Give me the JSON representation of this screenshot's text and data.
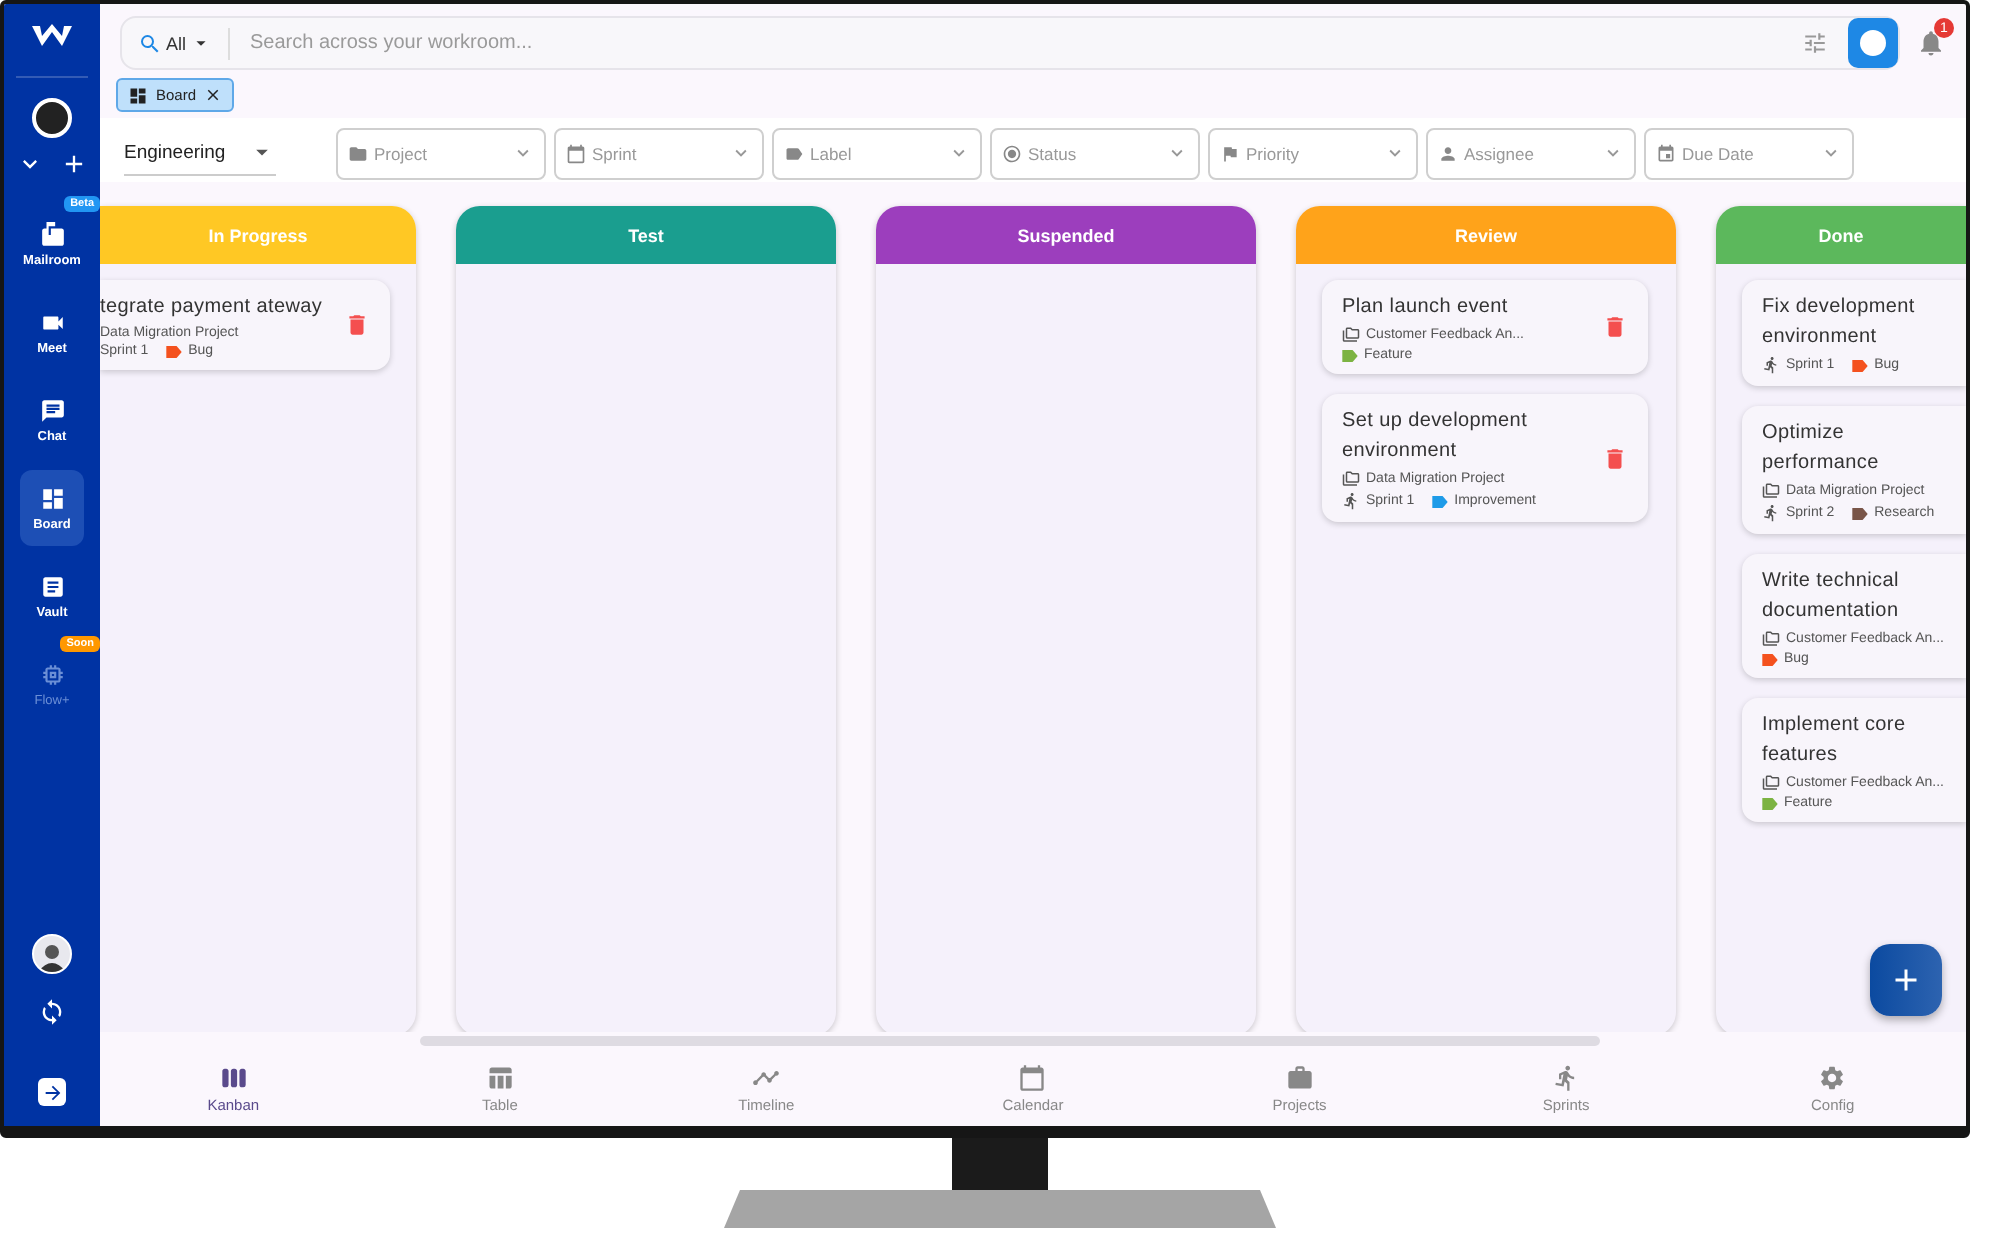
{
  "sidebar": {
    "items": [
      {
        "kind": "mailroom",
        "label": "Mailroom",
        "badge": {
          "text": "Beta",
          "color": "#2196f3"
        },
        "selected": false,
        "disabled": false
      },
      {
        "kind": "meet",
        "label": "Meet",
        "selected": false,
        "disabled": false
      },
      {
        "kind": "chat",
        "label": "Chat",
        "selected": false,
        "disabled": false
      },
      {
        "kind": "board",
        "label": "Board",
        "selected": true,
        "disabled": false
      },
      {
        "kind": "vault",
        "label": "Vault",
        "selected": false,
        "disabled": false
      },
      {
        "kind": "flow",
        "label": "Flow+",
        "badge": {
          "text": "Soon",
          "color": "#ff9800"
        },
        "selected": false,
        "disabled": true
      }
    ]
  },
  "search": {
    "scope": "All",
    "placeholder": "Search across your workroom..."
  },
  "notifications": {
    "count": "1"
  },
  "open_tabs": [
    {
      "label": "Board"
    }
  ],
  "team": "Engineering",
  "filters": [
    {
      "kind": "project",
      "placeholder": "Project"
    },
    {
      "kind": "sprint",
      "placeholder": "Sprint"
    },
    {
      "kind": "label",
      "placeholder": "Label"
    },
    {
      "kind": "status",
      "placeholder": "Status"
    },
    {
      "kind": "priority",
      "placeholder": "Priority"
    },
    {
      "kind": "assignee",
      "placeholder": "Assignee"
    },
    {
      "kind": "due",
      "placeholder": "Due Date"
    }
  ],
  "columns": [
    {
      "title": "In Progress",
      "color": "#ffc824",
      "cards": [
        {
          "title": "tegrate payment ateway",
          "project": "Data Migration Project",
          "sprint": "Sprint 1",
          "label": {
            "text": "Bug",
            "color": "#f4511e"
          },
          "deletable": true
        }
      ]
    },
    {
      "title": "Test",
      "color": "#1a9e8f"
    },
    {
      "title": "Suspended",
      "color": "#9c3ebd"
    },
    {
      "title": "Review",
      "color": "#ffa31a",
      "cards": [
        {
          "title": "Plan launch event",
          "project": "Customer Feedback An...",
          "label": {
            "text": "Feature",
            "color": "#7cb342"
          },
          "deletable": true
        },
        {
          "title": "Set up development environment",
          "project": "Data Migration Project",
          "sprint": "Sprint 1",
          "label": {
            "text": "Improvement",
            "color": "#1e9be8"
          },
          "deletable": true
        }
      ]
    },
    {
      "title": "Done",
      "color": "#5cb85c",
      "cards": [
        {
          "title": "Fix development environment",
          "sprint": "Sprint 1",
          "label": {
            "text": "Bug",
            "color": "#f4511e"
          },
          "deletable": false
        },
        {
          "title": "Optimize performance",
          "project": "Data Migration Project",
          "sprint": "Sprint 2",
          "label": {
            "text": "Research",
            "color": "#795548"
          },
          "deletable": false
        },
        {
          "title": "Write technical documentation",
          "project": "Customer Feedback An...",
          "label": {
            "text": "Bug",
            "color": "#f4511e"
          },
          "deletable": false
        },
        {
          "title": "Implement core features",
          "project": "Customer Feedback An...",
          "label": {
            "text": "Feature",
            "color": "#7cb342"
          },
          "deletable": false
        }
      ]
    }
  ],
  "bottom_nav": [
    {
      "kind": "kanban",
      "label": "Kanban",
      "selected": true
    },
    {
      "kind": "table",
      "label": "Table",
      "selected": false
    },
    {
      "kind": "timeline",
      "label": "Timeline",
      "selected": false
    },
    {
      "kind": "calendar",
      "label": "Calendar",
      "selected": false
    },
    {
      "kind": "projects",
      "label": "Projects",
      "selected": false
    },
    {
      "kind": "sprints",
      "label": "Sprints",
      "selected": false
    },
    {
      "kind": "config",
      "label": "Config",
      "selected": false
    }
  ]
}
